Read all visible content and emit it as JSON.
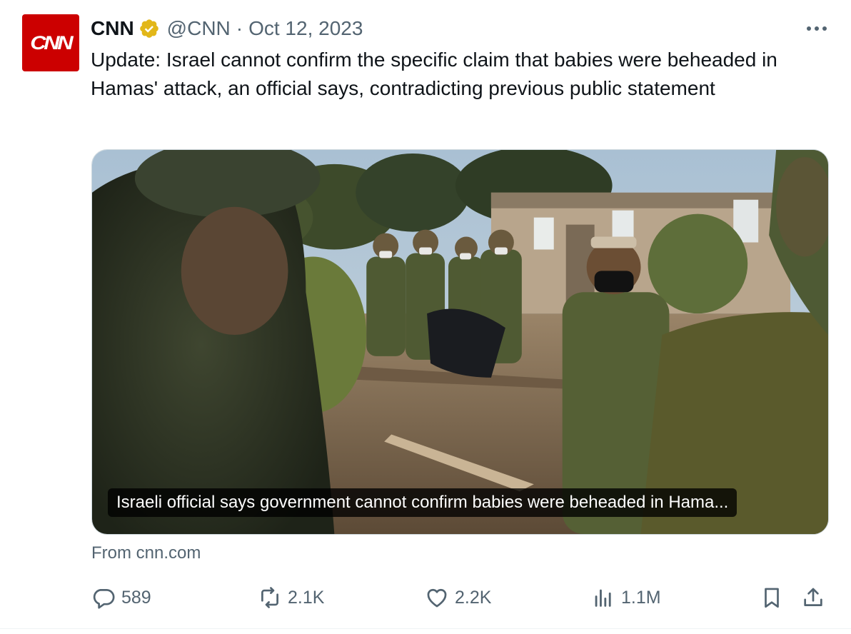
{
  "author": {
    "name": "CNN",
    "avatar_text": "CNN",
    "handle": "@CNN",
    "separator": "·",
    "date": "Oct 12, 2023",
    "verified_color": "#e2b719"
  },
  "tweet": {
    "text": "Update: Israel cannot confirm the specific claim that babies were beheaded in Hamas' attack, an official says, contradicting previous public statement"
  },
  "card": {
    "caption": "Israeli official says government cannot confirm babies were beheaded in Hama...",
    "source": "From cnn.com"
  },
  "actions": {
    "replies": "589",
    "retweets": "2.1K",
    "likes": "2.2K",
    "views": "1.1M"
  },
  "colors": {
    "brand_red": "#cc0000",
    "secondary_text": "#536471"
  }
}
